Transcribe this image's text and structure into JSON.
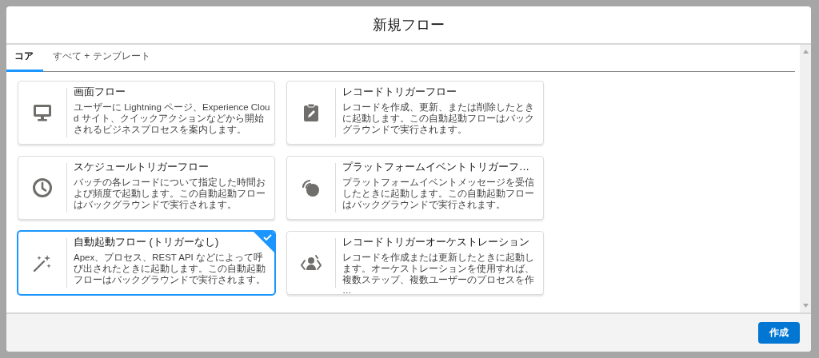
{
  "dialog": {
    "title": "新規フロー"
  },
  "tabs": [
    {
      "label": "コア",
      "selected": true
    },
    {
      "label": "すべて + テンプレート",
      "selected": false
    }
  ],
  "cards": [
    {
      "title": "画面フロー",
      "description": "ユーザーに Lightning ページ、Experience Cloud サイト、クイックアクションなどから開始されるビジネスプロセスを案内します。",
      "selected": false
    },
    {
      "title": "レコードトリガーフロー",
      "description": "レコードを作成、更新、または削除したときに起動します。この自動起動フローはバックグラウンドで実行されます。",
      "selected": false
    },
    {
      "title": "スケジュールトリガーフロー",
      "description": "バッチの各レコードについて指定した時間および頻度で起動します。この自動起動フローはバックグラウンドで実行されます。",
      "selected": false
    },
    {
      "title": "プラットフォームイベントトリガーフ…",
      "description": "プラットフォームイベントメッセージを受信したときに起動します。この自動起動フローはバックグラウンドで実行されます。",
      "selected": false
    },
    {
      "title": "自動起動フロー (トリガーなし)",
      "description": "Apex、プロセス、REST API などによって呼び出されたときに起動します。この自動起動フローはバックグラウンドで実行されます。",
      "selected": true
    },
    {
      "title": "レコードトリガーオーケストレーション",
      "description": "レコードを作成または更新したときに起動します。オーケストレーションを使用すれば、複数ステップ、複数ユーザーのプロセスを作 …",
      "selected": false
    }
  ],
  "footer": {
    "button": "作成"
  }
}
